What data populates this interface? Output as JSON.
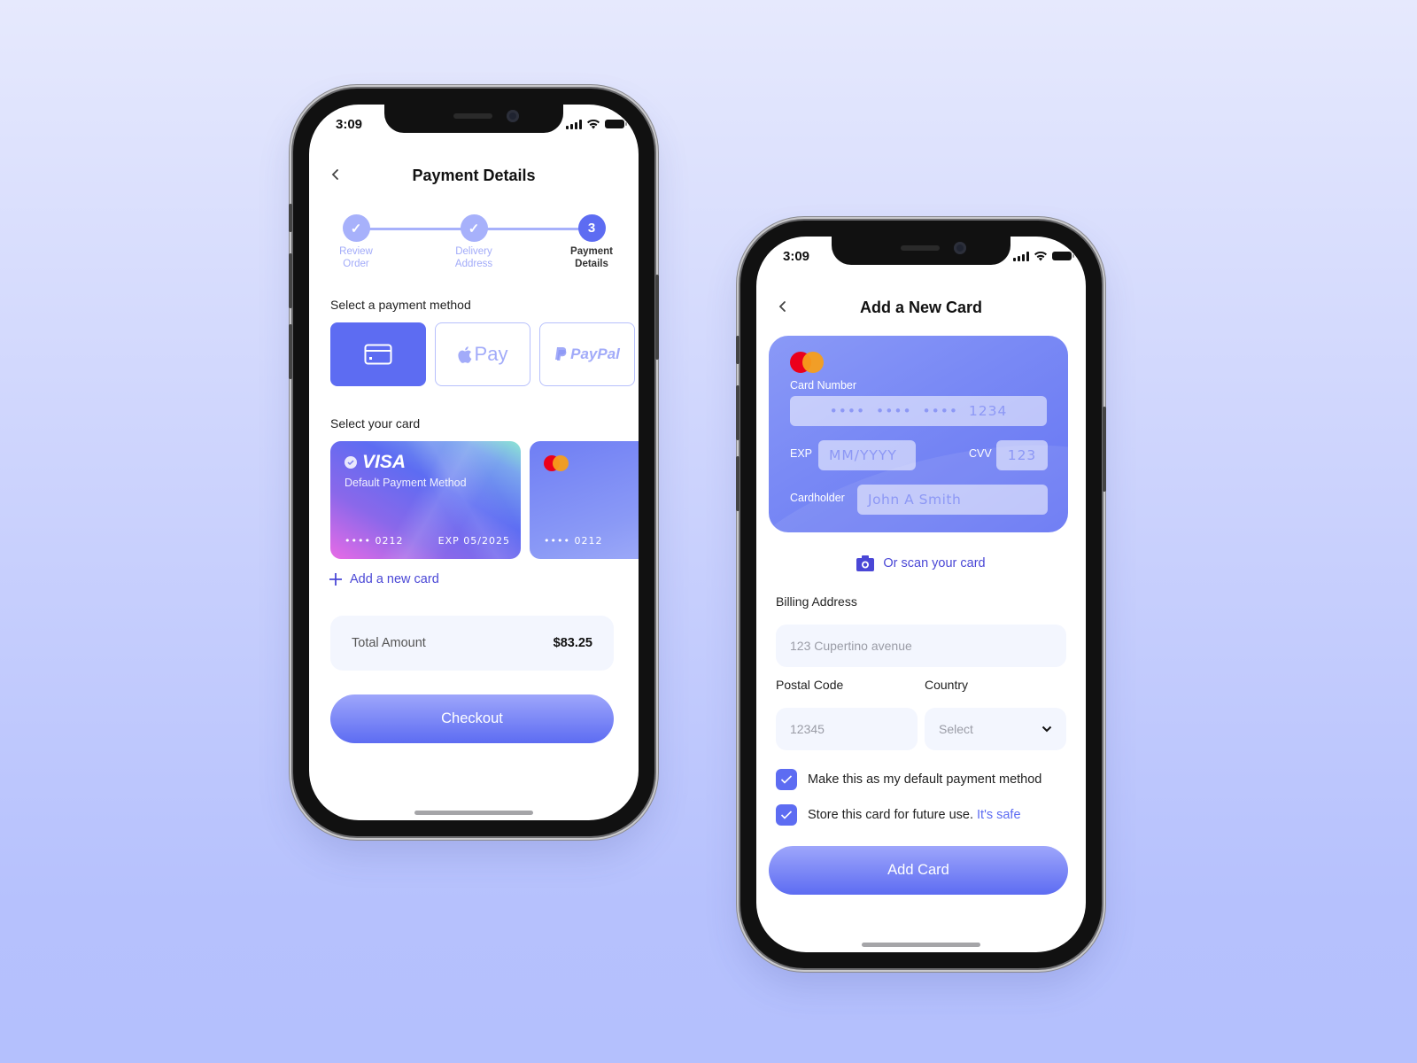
{
  "colors": {
    "accent": "#5d6cf2",
    "accent_light": "#a7b1fb",
    "link": "#4a47d6",
    "input_bg": "#f3f6fe",
    "mc_red": "#eb001b",
    "mc_orange": "#f79e1b"
  },
  "status_bar": {
    "time": "3:09"
  },
  "payment_screen": {
    "title": "Payment Details",
    "back_icon": "chevron-left-icon",
    "stepper": [
      {
        "label_line1": "Review",
        "label_line2": "Order",
        "state": "done",
        "marker": "✓"
      },
      {
        "label_line1": "Delivery",
        "label_line2": "Address",
        "state": "done",
        "marker": "✓"
      },
      {
        "label_line1": "Payment",
        "label_line2": "Details",
        "state": "active",
        "marker": "3"
      }
    ],
    "method_section_label": "Select a payment method",
    "methods": [
      {
        "name": "card",
        "icon": "credit-card-icon",
        "selected": true
      },
      {
        "name": "apple-pay",
        "label": "Pay",
        "icon": "apple-icon",
        "selected": false
      },
      {
        "name": "paypal",
        "label": "PayPal",
        "icon": "paypal-icon",
        "selected": false
      }
    ],
    "card_section_label": "Select your card",
    "cards": [
      {
        "brand": "VISA",
        "subtitle": "Default Payment Method",
        "number": "•••• 0212",
        "exp": "EXP 05/2025",
        "is_default": true
      },
      {
        "brand": "mastercard",
        "number": "•••• 0212"
      }
    ],
    "add_card_label": "Add a new card",
    "total": {
      "label": "Total Amount",
      "amount": "$83.25"
    },
    "checkout_label": "Checkout"
  },
  "add_card_screen": {
    "title": "Add a New Card",
    "back_icon": "chevron-left-icon",
    "card_form": {
      "card_number_label": "Card Number",
      "card_number_placeholder": "••••  ••••  ••••  1234",
      "exp_label": "EXP",
      "exp_placeholder": "MM/YYYY",
      "cvv_label": "CVV",
      "cvv_placeholder": "123",
      "cardholder_label": "Cardholder",
      "cardholder_placeholder": "John A Smith"
    },
    "scan_label": "Or scan your card",
    "billing_label": "Billing Address",
    "billing_placeholder": "123 Cupertino avenue",
    "postal_label": "Postal Code",
    "postal_placeholder": "12345",
    "country_label": "Country",
    "country_selected": "Select",
    "checkboxes": [
      {
        "label": "Make this as my default payment method",
        "checked": true
      },
      {
        "label": "Store this card for future use.",
        "link": "It's safe",
        "checked": true
      }
    ],
    "submit_label": "Add Card"
  }
}
